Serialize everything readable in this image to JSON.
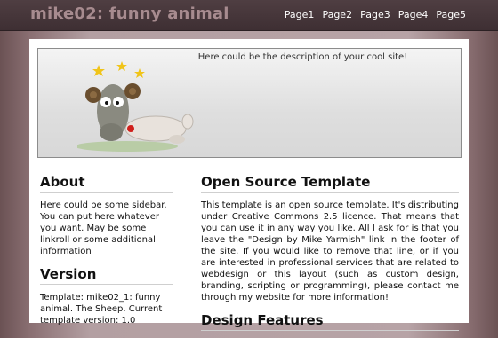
{
  "header": {
    "site_title": "mike02: funny animal",
    "nav": [
      "Page1",
      "Page2",
      "Page3",
      "Page4",
      "Page5"
    ]
  },
  "banner": {
    "description": "Here could be the description of your cool site!"
  },
  "sidebar": {
    "about_title": "About",
    "about_text": "Here could be some sidebar. You can put here whatever you want. May be some linkroll or some additional information",
    "version_title": "Version",
    "version_text": "Template: mike02_1: funny animal. The Sheep. Current template version: 1.0"
  },
  "main": {
    "title": "Open Source Template",
    "text": "This template is an open source template. It's distributing under Creative Commons 2.5 licence. That means that you can use it in any way you like. All I ask for is that you leave the \"Design by Mike Yarmish\" link in the footer of the site. If you would like to remove that line, or if you are interested in professional services that are related to webdesign or this layout (such as custom design, branding, scripting or programming), please contact me through my website for more information!",
    "next_title": "Design Features"
  }
}
